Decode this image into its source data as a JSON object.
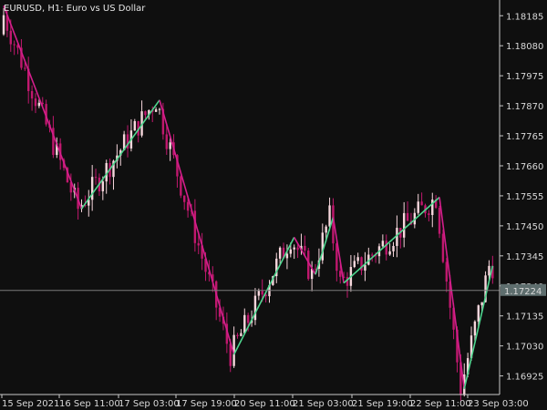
{
  "header": {
    "symbol": "EURUSD",
    "timeframe": "H1",
    "description": "Euro vs US Dollar"
  },
  "price_axis": {
    "ticks": [
      "1.18185",
      "1.18080",
      "1.17975",
      "1.17870",
      "1.17765",
      "1.17660",
      "1.17555",
      "1.17450",
      "1.17345",
      "1.17240",
      "1.17135",
      "1.17030",
      "1.16925"
    ]
  },
  "current_price": {
    "label": "1.17224",
    "value": 1.17224
  },
  "time_axis": {
    "ticks": [
      "15 Sep 2021",
      "16 Sep 11:00",
      "17 Sep 03:00",
      "17 Sep 19:00",
      "20 Sep 11:00",
      "21 Sep 03:00",
      "21 Sep 19:00",
      "22 Sep 11:00",
      "23 Sep 03:00"
    ]
  },
  "colors": {
    "background": "#0f0f0f",
    "axis": "#c8c8c8",
    "bull_candle": "#f6d6dc",
    "bear_candle": "#c0186e",
    "zigzag_down": "#d41e8c",
    "zigzag_up": "#4fd68f",
    "price_line": "#7a7a7a",
    "price_badge": "#5e6e6e"
  },
  "chart_data": {
    "type": "candlestick",
    "title": "EURUSD, H1:  Euro vs US Dollar",
    "ylim": [
      1.1686,
      1.1824
    ],
    "zigzag": [
      {
        "bar": 0,
        "price": 1.1822,
        "dir": "down"
      },
      {
        "bar": 22,
        "price": 1.1751,
        "dir": "up"
      },
      {
        "bar": 44,
        "price": 1.1789,
        "dir": "down"
      },
      {
        "bar": 65,
        "price": 1.17,
        "dir": "up"
      },
      {
        "bar": 82,
        "price": 1.1741,
        "dir": "down"
      },
      {
        "bar": 88,
        "price": 1.1728,
        "dir": "up"
      },
      {
        "bar": 93,
        "price": 1.1748,
        "dir": "down"
      },
      {
        "bar": 96,
        "price": 1.1725,
        "dir": "up"
      },
      {
        "bar": 123,
        "price": 1.1755,
        "dir": "down"
      },
      {
        "bar": 130,
        "price": 1.1688,
        "dir": "up"
      },
      {
        "bar": 138,
        "price": 1.1731,
        "dir": "up"
      }
    ],
    "candles": {
      "first_open": 1.1812,
      "bar_count": 139
    }
  }
}
